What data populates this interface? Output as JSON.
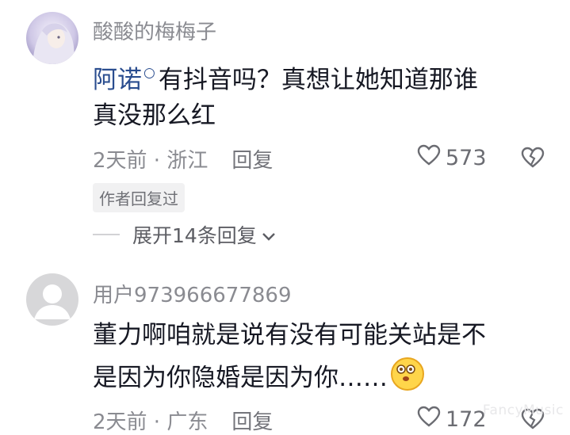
{
  "comments": [
    {
      "username": "酸酸的梅梅子",
      "mention": "阿诺",
      "line1": "有抖音吗？真想让她知道那谁",
      "line2": "真没那么红",
      "time_location": "2天前 · 浙江",
      "reply_label": "回复",
      "likes": "573",
      "badge": "作者回复过",
      "expand_label": "展开14条回复"
    },
    {
      "username": "用户973966677869",
      "line1": "董力啊咱就是说有没有可能关站是不",
      "line2": "是因为你隐婚是因为你……",
      "time_location": "2天前 · 广东",
      "reply_label": "回复",
      "likes": "172"
    }
  ],
  "watermark": "FancyMusic",
  "icons": {
    "like": "heart-icon",
    "dislike": "broken-heart-icon",
    "expand": "chevron-down-icon",
    "emoji": "dizzy-face-emoji"
  }
}
